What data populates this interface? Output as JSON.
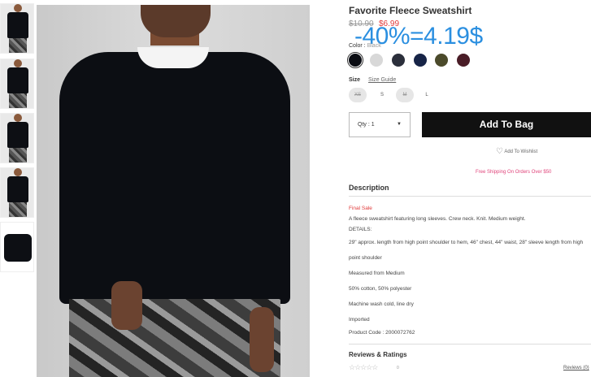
{
  "product": {
    "title": "Favorite Fleece Sweatshirt",
    "price_original": "$10.90",
    "price_sale": "$6.99",
    "promo_overlay": "-40%=4.19$"
  },
  "color": {
    "label": "Color :",
    "selected_name": "Black",
    "swatches": [
      "#0b0d14",
      "#d8d8d8",
      "#2b2f3b",
      "#172447",
      "#4b4a2b",
      "#4a1d27"
    ]
  },
  "size": {
    "label": "Size",
    "guide_label": "Size Guide",
    "options": [
      "XS",
      "S",
      "M",
      "L"
    ]
  },
  "purchase": {
    "qty_label": "Qty : 1",
    "add_to_bag": "Add To Bag",
    "wishlist": "Add To Wishlist",
    "shipping": "Free Shipping On Orders Over $50"
  },
  "description": {
    "heading": "Description",
    "final_sale": "Final Sale",
    "summary": "A fleece sweatshirt featuring long sleeves. Crew neck. Knit. Medium weight.",
    "details_label": "DETAILS:",
    "lines": [
      "29\" approx. length from high point shoulder to hem, 46\" chest, 44\" waist, 28\" sleeve length from high",
      "point shoulder",
      "Measured from Medium",
      "50% cotton, 50% polyester",
      "Machine wash cold, line dry",
      "Imported",
      "Product Code : 2000072762"
    ]
  },
  "reviews": {
    "heading": "Reviews & Ratings",
    "stars": "☆☆☆☆☆",
    "count": "0",
    "link": "Reviews (0)"
  }
}
